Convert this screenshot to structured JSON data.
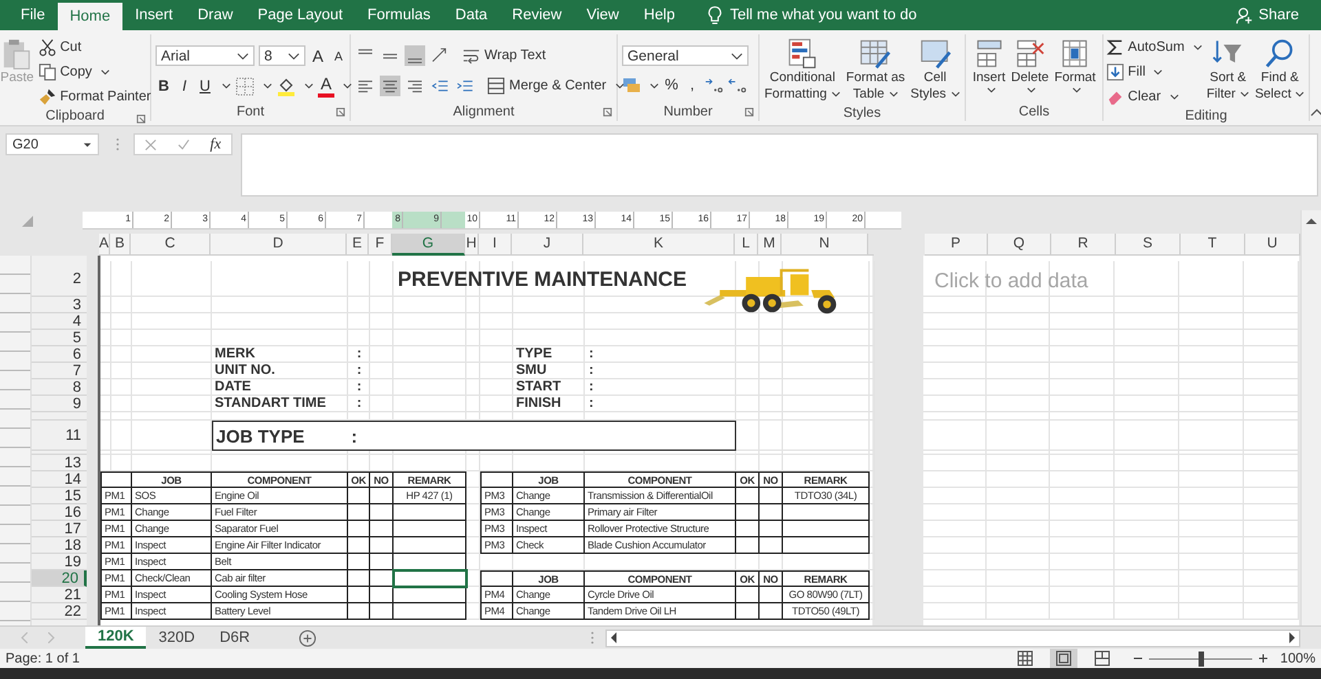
{
  "menu": {
    "tabs": [
      {
        "label": "File",
        "selected": false
      },
      {
        "label": "Home",
        "selected": true
      },
      {
        "label": "Insert",
        "selected": false
      },
      {
        "label": "Draw",
        "selected": false
      },
      {
        "label": "Page Layout",
        "selected": false
      },
      {
        "label": "Formulas",
        "selected": false
      },
      {
        "label": "Data",
        "selected": false
      },
      {
        "label": "Review",
        "selected": false
      },
      {
        "label": "View",
        "selected": false
      },
      {
        "label": "Help",
        "selected": false
      }
    ],
    "tell_me": "Tell me what you want to do",
    "share": "Share"
  },
  "ribbon": {
    "clipboard": {
      "paste": "Paste",
      "cut": "Cut",
      "copy": "Copy",
      "format_painter": "Format Painter",
      "label": "Clipboard"
    },
    "font": {
      "name": "Arial",
      "size": "8",
      "grow": "A",
      "shrink": "A",
      "styles": [
        "B",
        "I",
        "U"
      ],
      "font_color": "A",
      "label": "Font"
    },
    "alignment": {
      "vertical": [
        {
          "kind": "top",
          "selected": false
        },
        {
          "kind": "middle",
          "selected": false
        },
        {
          "kind": "bottom",
          "selected": true
        }
      ],
      "horizontal": [
        {
          "kind": "left",
          "selected": false
        },
        {
          "kind": "center",
          "selected": true
        },
        {
          "kind": "right",
          "selected": false
        }
      ],
      "wrap_text": "Wrap Text",
      "merge_center": "Merge & Center",
      "label": "Alignment"
    },
    "number": {
      "format": "General",
      "percent": "%",
      "comma": ",",
      "label": "Number"
    },
    "styles": {
      "buttons": [
        {
          "kind": "conditional",
          "label": "Conditional\nFormatting"
        },
        {
          "kind": "table",
          "label": "Format as\nTable"
        },
        {
          "kind": "cell",
          "label": "Cell\nStyles"
        }
      ],
      "label": "Styles"
    },
    "cells": {
      "buttons": [
        {
          "kind": "insert",
          "label": "Insert"
        },
        {
          "kind": "delete",
          "label": "Delete"
        },
        {
          "kind": "format",
          "label": "Format"
        }
      ],
      "label": "Cells"
    },
    "editing": {
      "autosum": "AutoSum",
      "fill": "Fill",
      "clear": "Clear",
      "sort_filter": "Sort &\nFilter",
      "find_select": "Find &\nSelect",
      "label": "Editing"
    }
  },
  "formula_bar": {
    "name_box": "G20",
    "fx": "fx"
  },
  "ruler": [
    "1",
    "2",
    "3",
    "4",
    "5",
    "6",
    "7",
    "8",
    "9",
    "10",
    "11",
    "12",
    "13",
    "14",
    "15",
    "16",
    "17",
    "18",
    "19",
    "20"
  ],
  "sheet": {
    "columns": [
      {
        "label": "A",
        "selected": false
      },
      {
        "label": "B",
        "selected": false
      },
      {
        "label": "C",
        "selected": false
      },
      {
        "label": "D",
        "selected": false
      },
      {
        "label": "E",
        "selected": false
      },
      {
        "label": "F",
        "selected": false
      },
      {
        "label": "G",
        "selected": true
      },
      {
        "label": "H",
        "selected": false
      },
      {
        "label": "I",
        "selected": false
      },
      {
        "label": "J",
        "selected": false
      },
      {
        "label": "K",
        "selected": false
      },
      {
        "label": "L",
        "selected": false
      },
      {
        "label": "M",
        "selected": false
      },
      {
        "label": "N",
        "selected": false
      }
    ],
    "right_columns": [
      "P",
      "Q",
      "R",
      "S",
      "T",
      "U"
    ],
    "rows": [
      {
        "label": "2",
        "selected": false
      },
      {
        "label": "3",
        "selected": false
      },
      {
        "label": "4",
        "selected": false
      },
      {
        "label": "5",
        "selected": false
      },
      {
        "label": "6",
        "selected": false
      },
      {
        "label": "7",
        "selected": false
      },
      {
        "label": "8",
        "selected": false
      },
      {
        "label": "9",
        "selected": false
      },
      {
        "selected": false
      },
      {
        "label": "11",
        "selected": false
      },
      {
        "selected": false
      },
      {
        "label": "13",
        "selected": false
      },
      {
        "label": "14",
        "selected": false
      },
      {
        "label": "15",
        "selected": false
      },
      {
        "label": "16",
        "selected": false
      },
      {
        "label": "17",
        "selected": false
      },
      {
        "label": "18",
        "selected": false
      },
      {
        "label": "19",
        "selected": false
      },
      {
        "label": "20",
        "selected": true
      },
      {
        "label": "21",
        "selected": false
      },
      {
        "label": "22",
        "selected": false
      }
    ],
    "title": "PREVENTIVE MAINTENANCE",
    "info_left": [
      {
        "label": "MERK",
        "colon": ":"
      },
      {
        "label": "UNIT NO.",
        "colon": ":"
      },
      {
        "label": "DATE",
        "colon": ":"
      },
      {
        "label": "STANDART TIME",
        "colon": ":"
      }
    ],
    "info_right": [
      {
        "label": "TYPE",
        "colon": ":"
      },
      {
        "label": "SMU",
        "colon": ":"
      },
      {
        "label": "START",
        "colon": ":"
      },
      {
        "label": "FINISH",
        "colon": ":"
      }
    ],
    "job_type": {
      "label": "JOB TYPE",
      "colon": ":"
    },
    "tables": [
      {
        "header": {
          "job": "JOB",
          "component": "COMPONENT",
          "ok": "OK",
          "no": "NO",
          "remark": "REMARK"
        },
        "rows": [
          {
            "code": "PM1",
            "job": "SOS",
            "component": "Engine Oil",
            "remark": "HP 427 (1)"
          },
          {
            "code": "PM1",
            "job": "Change",
            "component": "Fuel Filter"
          },
          {
            "code": "PM1",
            "job": "Change",
            "component": "Saparator Fuel"
          },
          {
            "code": "PM1",
            "job": "Inspect",
            "component": "Engine Air Filter Indicator"
          },
          {
            "code": "PM1",
            "job": "Inspect",
            "component": "Belt"
          },
          {
            "code": "PM1",
            "job": "Check/Clean",
            "component": "Cab air filter"
          },
          {
            "code": "PM1",
            "job": "Inspect",
            "component": "Cooling System Hose"
          },
          {
            "code": "PM1",
            "job": "Inspect",
            "component": "Battery Level"
          }
        ]
      },
      {
        "header": {
          "job": "JOB",
          "component": "COMPONENT",
          "ok": "OK",
          "no": "NO",
          "remark": "REMARK"
        },
        "rows": [
          {
            "code": "PM3",
            "job": "Change",
            "component": "Transmission & DifferentialOil",
            "remark": "TDTO30 (34L)"
          },
          {
            "code": "PM3",
            "job": "Change",
            "component": "Primary air Filter"
          },
          {
            "code": "PM3",
            "job": "Inspect",
            "component": "Rollover Protective Structure"
          },
          {
            "code": "PM3",
            "job": "Check",
            "component": "Blade Cushion Accumulator"
          }
        ]
      },
      {
        "header": {
          "job": "JOB",
          "component": "COMPONENT",
          "ok": "OK",
          "no": "NO",
          "remark": "REMARK"
        },
        "rows": [
          {
            "code": "PM4",
            "job": "Change",
            "component": "Cyrcle Drive Oil",
            "remark": "GO 80W90 (7LT)"
          },
          {
            "code": "PM4",
            "job": "Change",
            "component": "Tandem Drive Oil LH",
            "remark": "TDTO50 (49LT)"
          }
        ]
      }
    ],
    "placeholder": "Click to add data"
  },
  "sheet_tabs": [
    {
      "label": "120K",
      "selected": true
    },
    {
      "label": "320D",
      "selected": false
    },
    {
      "label": "D6R",
      "selected": false
    }
  ],
  "status": {
    "page": "Page: 1 of 1",
    "views": [
      {
        "kind": "normal",
        "selected": false
      },
      {
        "kind": "page_layout",
        "selected": true
      },
      {
        "kind": "page_break",
        "selected": false
      }
    ],
    "zoom": {
      "level": 0.5,
      "reading": "100%"
    }
  }
}
